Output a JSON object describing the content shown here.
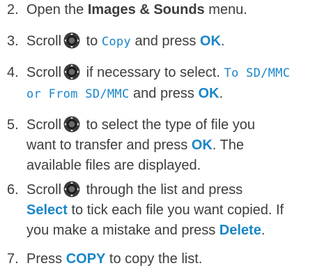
{
  "steps": [
    {
      "num": "2.",
      "pre": "Open the ",
      "menu": "Images & Sounds",
      "post": " menu."
    },
    {
      "num": "3.",
      "pre": "Scroll",
      "mid": " to ",
      "lcd": "Copy",
      "and": " and press ",
      "key": "OK",
      "end": "."
    },
    {
      "num": "4.",
      "pre": "Scroll",
      "mid": " if necessary to select. ",
      "lcd1": "To SD/MMC",
      "lcd2": "or From SD/MMC",
      "and": " and press ",
      "key": "OK",
      "end": "."
    },
    {
      "num": "5.",
      "pre": "Scroll",
      "mid": " to select the type of file you",
      "line2a": "want to transfer and press ",
      "key": "OK",
      "line2b": ". The",
      "line3": "available files are displayed."
    },
    {
      "num": "6.",
      "pre": "Scroll",
      "mid": " through the list and press",
      "key1": "Select",
      "line2": " to tick each file you want copied. If",
      "line3a": "you make a mistake and press ",
      "key2": "Delete",
      "end": "."
    },
    {
      "num": "7.",
      "pre": "Press ",
      "key": "COPY",
      "post": " to copy the list."
    }
  ],
  "icons": {
    "nav": "navigation-key-icon"
  },
  "colors": {
    "text": "#3d3d3d",
    "accent": "#1a86c8"
  }
}
